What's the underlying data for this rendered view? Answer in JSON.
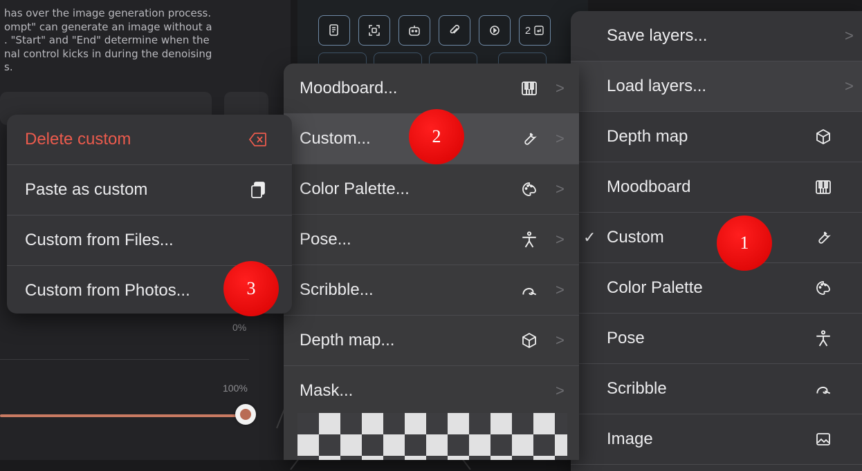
{
  "background": {
    "description_lines": [
      "has over the image generation process.",
      "ompt\" can generate an image without a",
      ". \"Start\" and \"End\" determine when the",
      "nal control kicks in during the denoising",
      "s."
    ],
    "percent_low": "0%",
    "percent_high": "100%",
    "slider_value": 1.0,
    "toolbar_icons": [
      "scroll-icon",
      "focus-icon",
      "robot-icon",
      "paperclip-icon",
      "play-icon",
      "pages-icon"
    ],
    "toolbar_pages_label": "2"
  },
  "main_menu": {
    "items": [
      {
        "label": "Save layers...",
        "icon": "",
        "chevron": ">"
      },
      {
        "label": "Load layers...",
        "icon": "",
        "chevron": ">"
      },
      {
        "label": "Depth map",
        "icon": "cube-icon"
      },
      {
        "label": "Moodboard",
        "icon": "piano-icon"
      },
      {
        "label": "Custom",
        "icon": "wrench-icon",
        "checked": "✓"
      },
      {
        "label": "Color Palette",
        "icon": "palette-icon"
      },
      {
        "label": "Pose",
        "icon": "person-icon"
      },
      {
        "label": "Scribble",
        "icon": "scribble-icon"
      },
      {
        "label": "Image",
        "icon": "image-icon"
      }
    ]
  },
  "sub_menu": {
    "items": [
      {
        "label": "Moodboard...",
        "icon": "piano-icon",
        "chevron": ">"
      },
      {
        "label": "Custom...",
        "icon": "wrench-icon",
        "chevron": ">"
      },
      {
        "label": "Color Palette...",
        "icon": "palette-icon",
        "chevron": ">"
      },
      {
        "label": "Pose...",
        "icon": "person-icon",
        "chevron": ">"
      },
      {
        "label": "Scribble...",
        "icon": "scribble-icon",
        "chevron": ">"
      },
      {
        "label": "Depth map...",
        "icon": "cube-icon",
        "chevron": ">"
      },
      {
        "label": "Mask...",
        "icon": "",
        "chevron": ">"
      }
    ]
  },
  "custom_menu": {
    "items": [
      {
        "label": "Delete custom",
        "icon": "delete-icon"
      },
      {
        "label": "Paste as custom",
        "icon": "clipboard-icon"
      },
      {
        "label": "Custom from Files...",
        "icon": ""
      },
      {
        "label": "Custom from Photos...",
        "icon": ""
      }
    ]
  },
  "annotations": [
    "1",
    "2",
    "3"
  ],
  "colors": {
    "danger": "#ec5b4d",
    "badge": "#e60000",
    "accent": "#c97a62"
  }
}
